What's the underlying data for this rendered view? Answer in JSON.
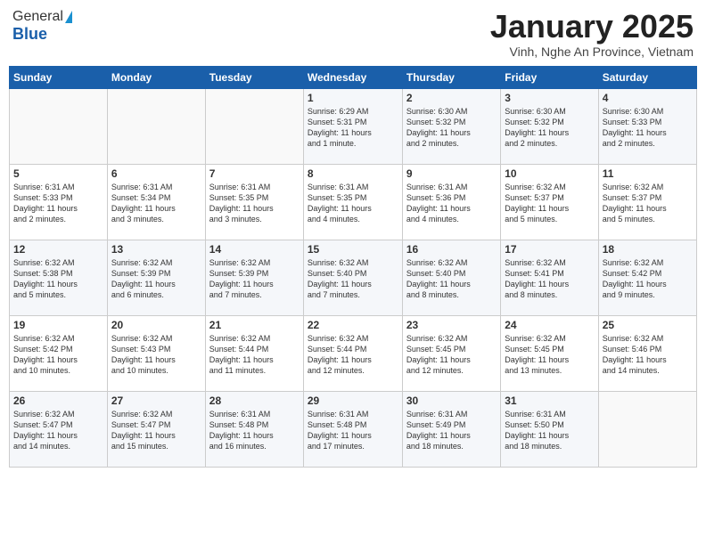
{
  "header": {
    "logo_general": "General",
    "logo_blue": "Blue",
    "month_title": "January 2025",
    "subtitle": "Vinh, Nghe An Province, Vietnam"
  },
  "days_of_week": [
    "Sunday",
    "Monday",
    "Tuesday",
    "Wednesday",
    "Thursday",
    "Friday",
    "Saturday"
  ],
  "weeks": [
    [
      {
        "num": "",
        "text": ""
      },
      {
        "num": "",
        "text": ""
      },
      {
        "num": "",
        "text": ""
      },
      {
        "num": "1",
        "text": "Sunrise: 6:29 AM\nSunset: 5:31 PM\nDaylight: 11 hours\nand 1 minute."
      },
      {
        "num": "2",
        "text": "Sunrise: 6:30 AM\nSunset: 5:32 PM\nDaylight: 11 hours\nand 2 minutes."
      },
      {
        "num": "3",
        "text": "Sunrise: 6:30 AM\nSunset: 5:32 PM\nDaylight: 11 hours\nand 2 minutes."
      },
      {
        "num": "4",
        "text": "Sunrise: 6:30 AM\nSunset: 5:33 PM\nDaylight: 11 hours\nand 2 minutes."
      }
    ],
    [
      {
        "num": "5",
        "text": "Sunrise: 6:31 AM\nSunset: 5:33 PM\nDaylight: 11 hours\nand 2 minutes."
      },
      {
        "num": "6",
        "text": "Sunrise: 6:31 AM\nSunset: 5:34 PM\nDaylight: 11 hours\nand 3 minutes."
      },
      {
        "num": "7",
        "text": "Sunrise: 6:31 AM\nSunset: 5:35 PM\nDaylight: 11 hours\nand 3 minutes."
      },
      {
        "num": "8",
        "text": "Sunrise: 6:31 AM\nSunset: 5:35 PM\nDaylight: 11 hours\nand 4 minutes."
      },
      {
        "num": "9",
        "text": "Sunrise: 6:31 AM\nSunset: 5:36 PM\nDaylight: 11 hours\nand 4 minutes."
      },
      {
        "num": "10",
        "text": "Sunrise: 6:32 AM\nSunset: 5:37 PM\nDaylight: 11 hours\nand 5 minutes."
      },
      {
        "num": "11",
        "text": "Sunrise: 6:32 AM\nSunset: 5:37 PM\nDaylight: 11 hours\nand 5 minutes."
      }
    ],
    [
      {
        "num": "12",
        "text": "Sunrise: 6:32 AM\nSunset: 5:38 PM\nDaylight: 11 hours\nand 5 minutes."
      },
      {
        "num": "13",
        "text": "Sunrise: 6:32 AM\nSunset: 5:39 PM\nDaylight: 11 hours\nand 6 minutes."
      },
      {
        "num": "14",
        "text": "Sunrise: 6:32 AM\nSunset: 5:39 PM\nDaylight: 11 hours\nand 7 minutes."
      },
      {
        "num": "15",
        "text": "Sunrise: 6:32 AM\nSunset: 5:40 PM\nDaylight: 11 hours\nand 7 minutes."
      },
      {
        "num": "16",
        "text": "Sunrise: 6:32 AM\nSunset: 5:40 PM\nDaylight: 11 hours\nand 8 minutes."
      },
      {
        "num": "17",
        "text": "Sunrise: 6:32 AM\nSunset: 5:41 PM\nDaylight: 11 hours\nand 8 minutes."
      },
      {
        "num": "18",
        "text": "Sunrise: 6:32 AM\nSunset: 5:42 PM\nDaylight: 11 hours\nand 9 minutes."
      }
    ],
    [
      {
        "num": "19",
        "text": "Sunrise: 6:32 AM\nSunset: 5:42 PM\nDaylight: 11 hours\nand 10 minutes."
      },
      {
        "num": "20",
        "text": "Sunrise: 6:32 AM\nSunset: 5:43 PM\nDaylight: 11 hours\nand 10 minutes."
      },
      {
        "num": "21",
        "text": "Sunrise: 6:32 AM\nSunset: 5:44 PM\nDaylight: 11 hours\nand 11 minutes."
      },
      {
        "num": "22",
        "text": "Sunrise: 6:32 AM\nSunset: 5:44 PM\nDaylight: 11 hours\nand 12 minutes."
      },
      {
        "num": "23",
        "text": "Sunrise: 6:32 AM\nSunset: 5:45 PM\nDaylight: 11 hours\nand 12 minutes."
      },
      {
        "num": "24",
        "text": "Sunrise: 6:32 AM\nSunset: 5:45 PM\nDaylight: 11 hours\nand 13 minutes."
      },
      {
        "num": "25",
        "text": "Sunrise: 6:32 AM\nSunset: 5:46 PM\nDaylight: 11 hours\nand 14 minutes."
      }
    ],
    [
      {
        "num": "26",
        "text": "Sunrise: 6:32 AM\nSunset: 5:47 PM\nDaylight: 11 hours\nand 14 minutes."
      },
      {
        "num": "27",
        "text": "Sunrise: 6:32 AM\nSunset: 5:47 PM\nDaylight: 11 hours\nand 15 minutes."
      },
      {
        "num": "28",
        "text": "Sunrise: 6:31 AM\nSunset: 5:48 PM\nDaylight: 11 hours\nand 16 minutes."
      },
      {
        "num": "29",
        "text": "Sunrise: 6:31 AM\nSunset: 5:48 PM\nDaylight: 11 hours\nand 17 minutes."
      },
      {
        "num": "30",
        "text": "Sunrise: 6:31 AM\nSunset: 5:49 PM\nDaylight: 11 hours\nand 18 minutes."
      },
      {
        "num": "31",
        "text": "Sunrise: 6:31 AM\nSunset: 5:50 PM\nDaylight: 11 hours\nand 18 minutes."
      },
      {
        "num": "",
        "text": ""
      }
    ]
  ]
}
